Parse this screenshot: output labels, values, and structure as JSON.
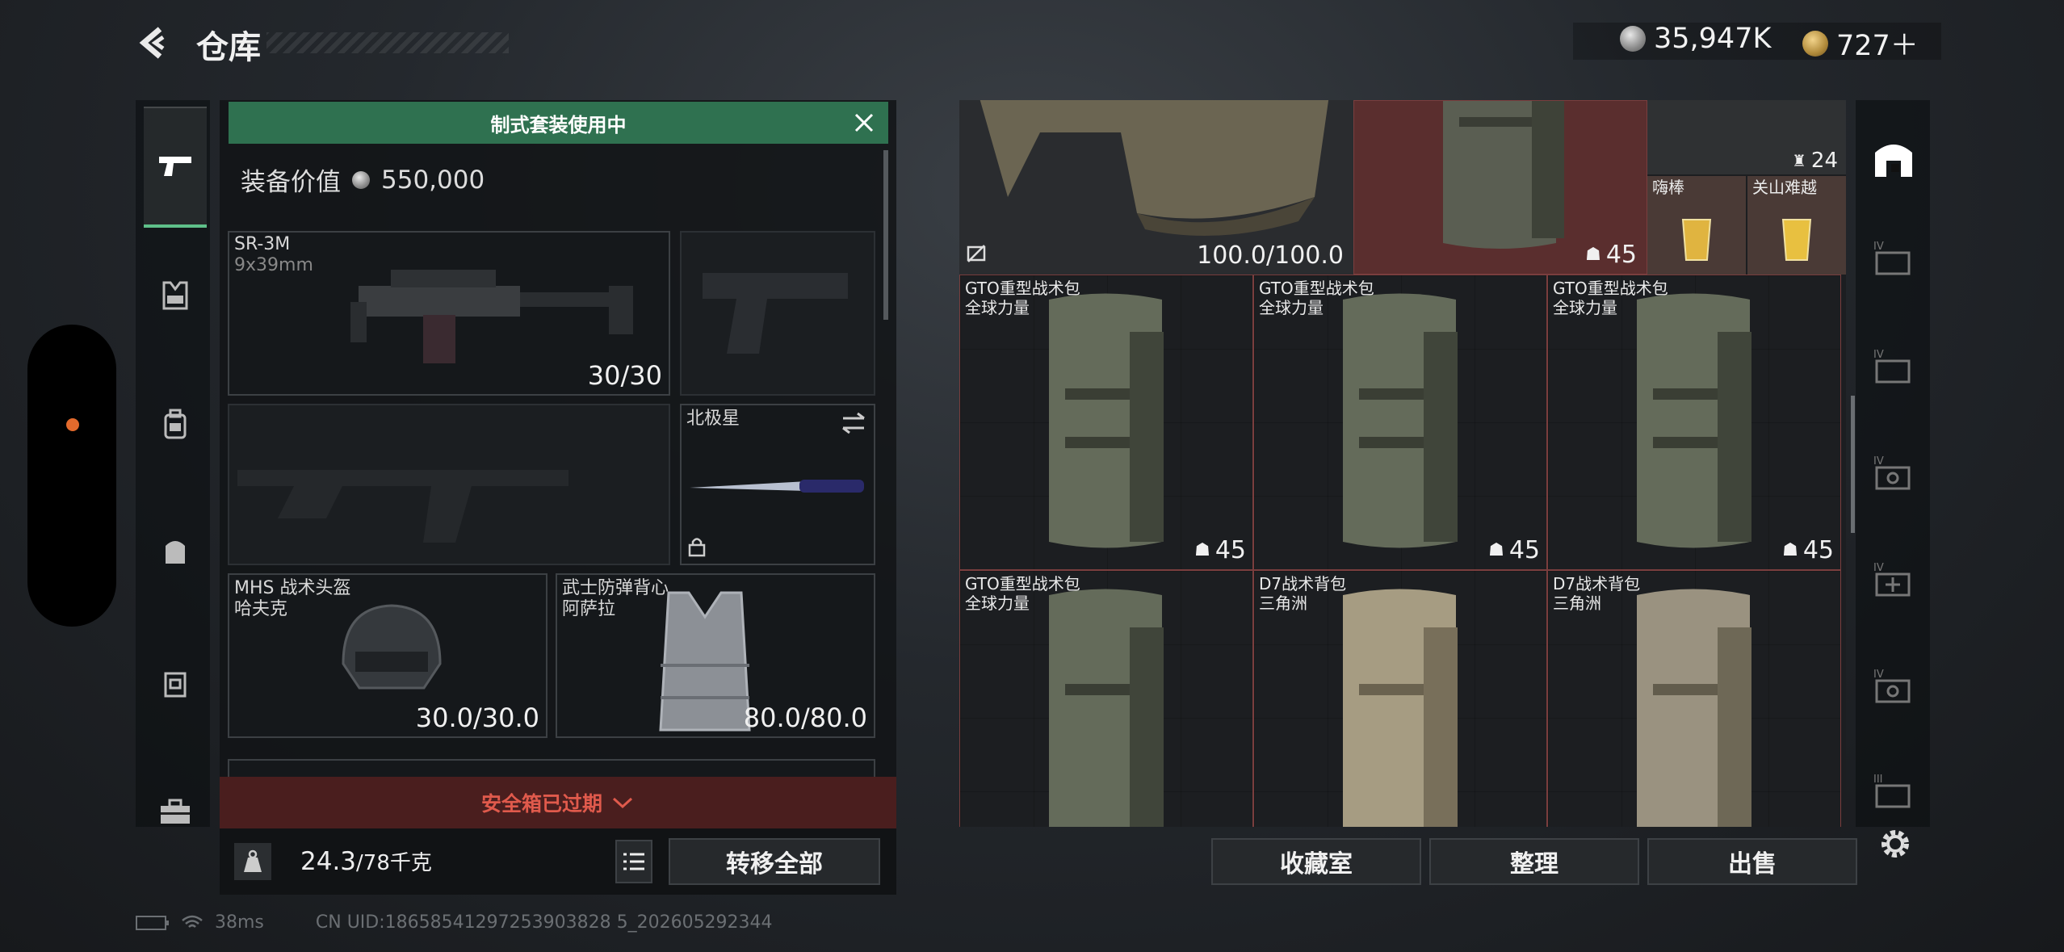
{
  "header": {
    "title": "仓库",
    "currency_silver": "35,947K",
    "currency_gold": "727＋"
  },
  "loadout": {
    "kit_banner": "制式套装使用中",
    "equip_value_label": "装备价值",
    "equip_value": "550,000",
    "primary": {
      "name": "SR-3M",
      "ammo": "9x39mm",
      "count": "30/30"
    },
    "melee": {
      "name": "北极星"
    },
    "helmet": {
      "name": "MHS 战术头盔",
      "brand": "哈夫克",
      "durability": "30.0/30.0"
    },
    "armor": {
      "name": "武士防弹背心",
      "brand": "阿萨拉",
      "durability": "80.0/80.0"
    },
    "safe_box": "安全箱已过期",
    "weight": "24.3",
    "weight_max": "/78千克",
    "transfer_all": "转移全部"
  },
  "storage": {
    "top_durability": "100.0/100.0",
    "top_bag_count": "45",
    "top_item_count": "24",
    "drink1": "嗨棒",
    "drink2": "关山难越",
    "items": [
      {
        "name": "GTO重型战术包",
        "brand": "全球力量",
        "count": "45"
      },
      {
        "name": "GTO重型战术包",
        "brand": "全球力量",
        "count": "45"
      },
      {
        "name": "GTO重型战术包",
        "brand": "全球力量",
        "count": "45"
      },
      {
        "name": "GTO重型战术包",
        "brand": "全球力量"
      },
      {
        "name": "D7战术背包",
        "brand": "三角洲"
      },
      {
        "name": "D7战术背包",
        "brand": "三角洲"
      }
    ],
    "buttons": {
      "collection": "收藏室",
      "organize": "整理",
      "sell": "出售"
    }
  },
  "status": {
    "ping": "38ms",
    "uid": "CN UID:18658541297253903828 5_202605292344"
  },
  "colors": {
    "accent_green": "#2f7150",
    "cell_red": "#5a2e2e",
    "warning_red": "#e05a4c"
  }
}
